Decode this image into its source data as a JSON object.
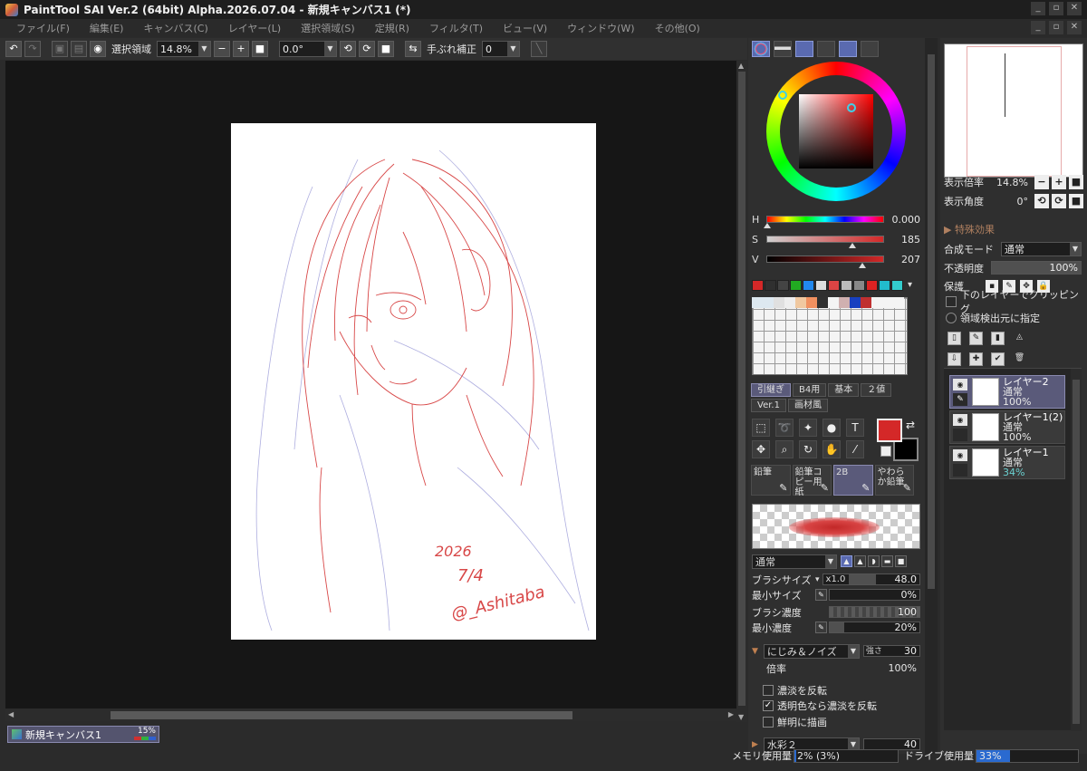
{
  "window": {
    "title": "PaintTool SAI Ver.2 (64bit) Alpha.2026.07.04 - 新規キャンバス1 (*)"
  },
  "menu": [
    "ファイル(F)",
    "編集(E)",
    "キャンバス(C)",
    "レイヤー(L)",
    "選択領域(S)",
    "定規(R)",
    "フィルタ(T)",
    "ビュー(V)",
    "ウィンドウ(W)",
    "その他(O)"
  ],
  "toolbar": {
    "selection_label": "選択領域",
    "zoom_value": "14.8%",
    "rotation_value": "0.0°",
    "stabilizer_label": "手ぶれ補正",
    "stabilizer_value": "0"
  },
  "artwork": {
    "signature_year": "2026",
    "signature_date": "7/4",
    "signature_name": "@_Ashitaba"
  },
  "doc_tab": {
    "label": "新規キャンバス1",
    "progress_text": "15%"
  },
  "color": {
    "h_label": "H",
    "h_value": "0.000",
    "h_pos": 0.0,
    "s_label": "S",
    "s_value": "185",
    "s_pos": 0.725,
    "v_label": "V",
    "v_value": "207",
    "v_pos": 0.81,
    "foreground": "#d42828",
    "background": "#000000"
  },
  "swatches": [
    "#d42828",
    "#303030",
    "#444444",
    "#22aa22",
    "#2288ee",
    "#dddddd",
    "#dd4444",
    "#bbbbbb",
    "#888888",
    "#dd2222",
    "#22bbcc",
    "#33cccc"
  ],
  "palette_top": [
    "#dde8f0",
    "#dde8f0",
    "#e0e0e0",
    "#eeeeee",
    "#f0c8a0",
    "#f09060",
    "#303030",
    "#f4f4f4",
    "#d0b0b0",
    "#1840c0",
    "#c03030",
    "#f4f4f4",
    "#f4f4f4",
    "#f4f4f4"
  ],
  "brush_sets": [
    "引継ぎ",
    "B4用",
    "基本",
    "２値",
    "Ver.1",
    "画材風"
  ],
  "brushes": [
    {
      "name": "鉛筆"
    },
    {
      "name": "鉛筆コピー用紙"
    },
    {
      "name": "2B"
    },
    {
      "name": "やわらか鉛筆"
    }
  ],
  "brush_props": {
    "blend_mode": "通常",
    "size_label": "ブラシサイズ",
    "size_multiplier": "x1.0",
    "size_value": "48.0",
    "min_size_label": "最小サイズ",
    "min_size_value": "0%",
    "density_label": "ブラシ濃度",
    "density_value": "100",
    "min_density_label": "最小濃度",
    "min_density_value": "20%",
    "texture_name": "にじみ＆ノイズ",
    "texture_strength_label": "強さ",
    "texture_strength": "30",
    "scale_label": "倍率",
    "scale_value": "100%",
    "invert_label": "濃淡を反転",
    "invert_transparent_label": "透明色なら濃淡を反転",
    "vivid_label": "鮮明に描画",
    "second_texture": "水彩２",
    "second_strength": "40"
  },
  "navigator": {
    "zoom_label": "表示倍率",
    "zoom_value": "14.8%",
    "angle_label": "表示角度",
    "angle_value": "0°"
  },
  "layer_panel": {
    "effects_label": "特殊効果",
    "blend_label": "合成モード",
    "blend_value": "通常",
    "opacity_label": "不透明度",
    "opacity_value": "100%",
    "protect_label": "保護",
    "clip_label": "下のレイヤーでクリッピング",
    "selection_source_label": "領域検出元に指定"
  },
  "layers": [
    {
      "name": "レイヤー2",
      "mode": "通常",
      "opacity": "100%"
    },
    {
      "name": "レイヤー1(2)",
      "mode": "通常",
      "opacity": "100%"
    },
    {
      "name": "レイヤー1",
      "mode": "通常",
      "opacity": "34%"
    }
  ],
  "status": {
    "memory_label": "メモリ使用量",
    "memory_value": "2% (3%)",
    "memory_level": 0.02,
    "drive_label": "ドライブ使用量",
    "drive_value": "33%",
    "drive_level": 0.33
  }
}
